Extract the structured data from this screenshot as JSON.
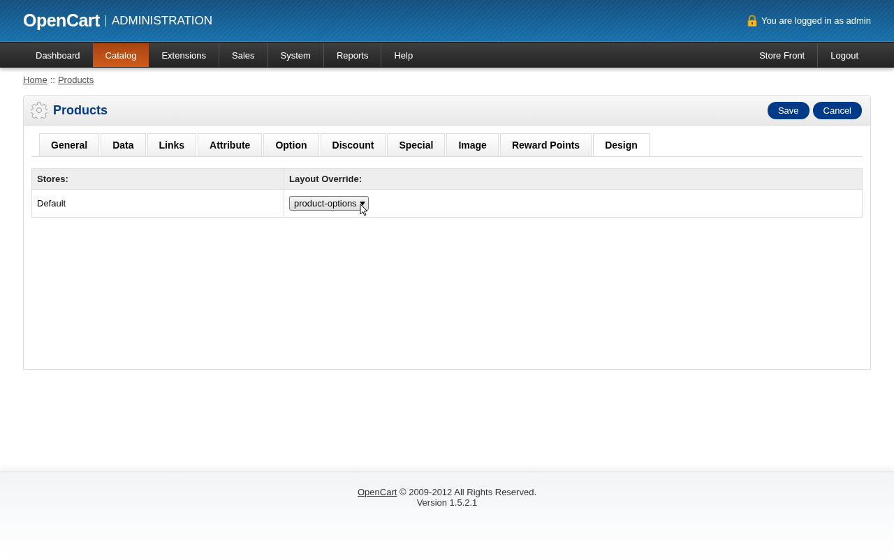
{
  "header": {
    "logo": "OpenCart",
    "subtitle": "ADMINISTRATION",
    "login_text": "You are logged in as admin"
  },
  "menu": [
    {
      "label": "Dashboard",
      "selected": false
    },
    {
      "label": "Catalog",
      "selected": true
    },
    {
      "label": "Extensions",
      "selected": false
    },
    {
      "label": "Sales",
      "selected": false
    },
    {
      "label": "System",
      "selected": false
    },
    {
      "label": "Reports",
      "selected": false
    },
    {
      "label": "Help",
      "selected": false
    }
  ],
  "menu_right": [
    "Store Front",
    "Logout"
  ],
  "breadcrumb": {
    "items": [
      "Home",
      "Products"
    ],
    "separator": "::"
  },
  "panel": {
    "title": "Products",
    "buttons": [
      "Save",
      "Cancel"
    ]
  },
  "tabs": [
    {
      "label": "General",
      "selected": false
    },
    {
      "label": "Data",
      "selected": false
    },
    {
      "label": "Links",
      "selected": false
    },
    {
      "label": "Attribute",
      "selected": false
    },
    {
      "label": "Option",
      "selected": false
    },
    {
      "label": "Discount",
      "selected": false
    },
    {
      "label": "Special",
      "selected": false
    },
    {
      "label": "Image",
      "selected": false
    },
    {
      "label": "Reward Points",
      "selected": false
    },
    {
      "label": "Design",
      "selected": true
    }
  ],
  "table": {
    "columns": [
      "Stores:",
      "Layout Override:"
    ],
    "rows": [
      {
        "store": "Default",
        "layout": "product-options"
      }
    ]
  },
  "footer": {
    "link": "OpenCart",
    "text": " © 2009-2012 All Rights Reserved.",
    "version": "Version 1.5.2.1"
  }
}
